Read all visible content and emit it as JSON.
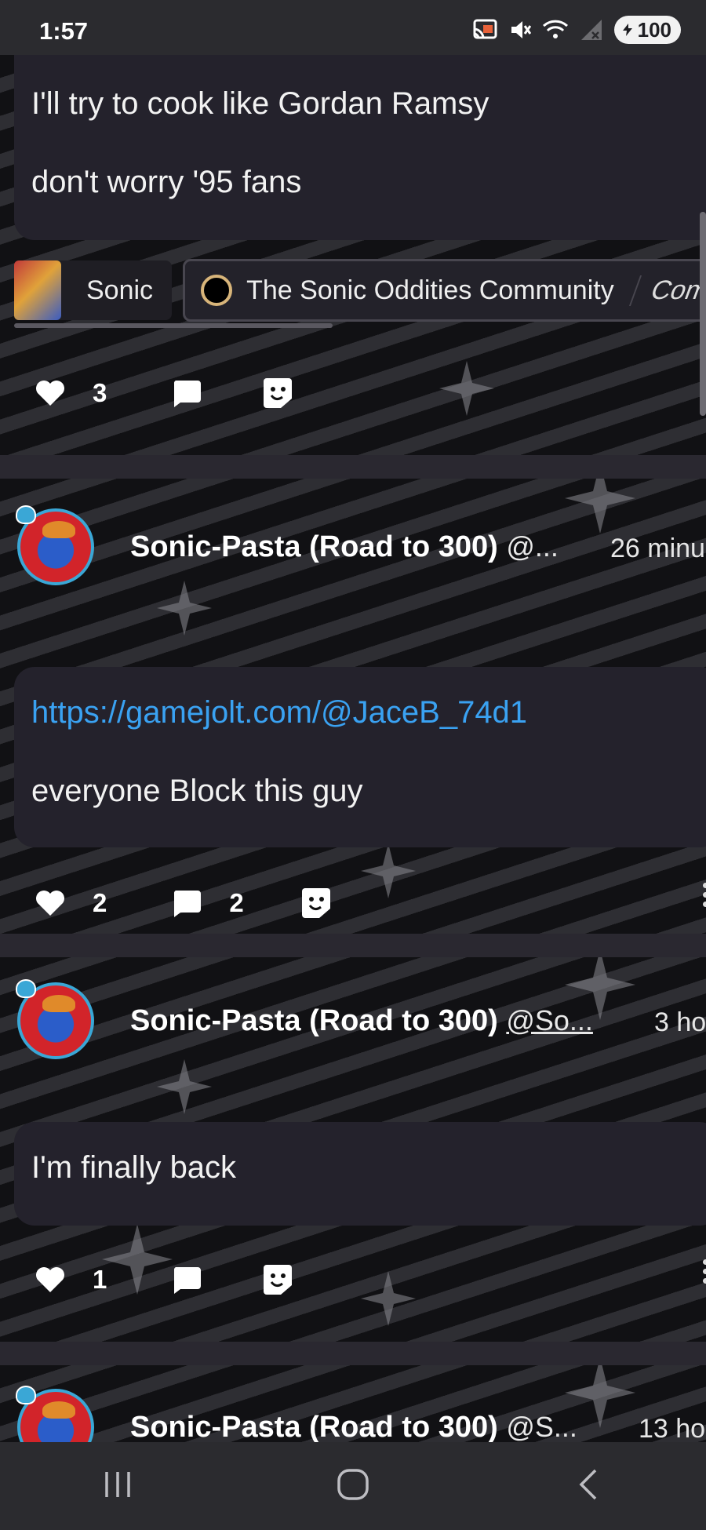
{
  "status_bar": {
    "time": "1:57",
    "battery": "100",
    "icons": [
      "cast-icon",
      "mute-icon",
      "wifi-icon",
      "signal-icon",
      "battery-icon"
    ]
  },
  "posts": [
    {
      "lines": [
        "I'll try to cook like Gordan Ramsy",
        "don't worry '95 fans"
      ],
      "communities": [
        "Sonic",
        "The Sonic Oddities Community",
        "Com"
      ],
      "likes": "3",
      "comments": ""
    },
    {
      "author": "Sonic-Pasta (Road to 300)",
      "handle": "@...",
      "time": "26 minu",
      "link": "https://gamejolt.com/@JaceB_74d1",
      "text": "everyone Block this guy",
      "likes": "2",
      "comments": "2"
    },
    {
      "author": "Sonic-Pasta (Road to 300)",
      "handle": "@So...",
      "time": "3 ho",
      "text": "I'm finally back",
      "likes": "1",
      "comments": ""
    },
    {
      "author": "Sonic-Pasta (Road to 300)",
      "handle": "@S...",
      "time": "13 ho"
    }
  ],
  "colors": {
    "link": "#3aa2f2",
    "bubble": "#24222c",
    "bar": "#2b2b2f"
  }
}
